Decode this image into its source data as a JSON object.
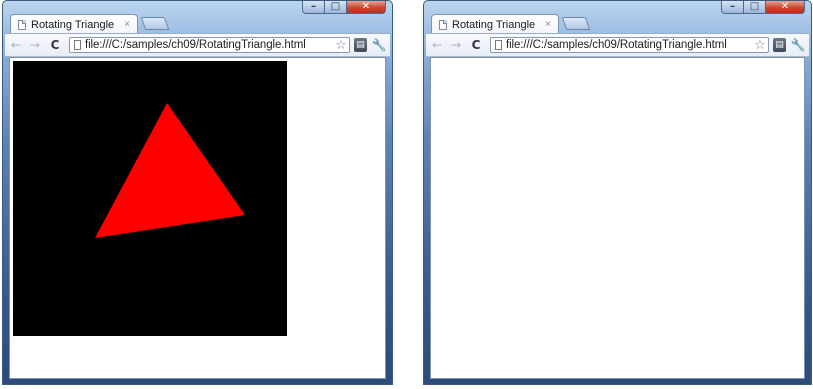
{
  "windows": [
    {
      "tab": {
        "title": "Rotating Triangle",
        "close": "×"
      },
      "url": "file:///C:/samples/ch09/RotatingTriangle.html",
      "canvas_visible": true
    },
    {
      "tab": {
        "title": "Rotating Triangle",
        "close": "×"
      },
      "url": "file:///C:/samples/ch09/RotatingTriangle.html",
      "canvas_visible": false
    }
  ],
  "icons": {
    "back": "back-arrow-icon",
    "forward": "forward-arrow-icon",
    "reload": "reload-icon",
    "star": "star-icon",
    "page_menu": "page-menu-icon",
    "wrench": "wrench-icon",
    "minimize": "minimize-icon",
    "maximize": "maximize-icon",
    "close": "close-icon"
  },
  "colors": {
    "triangle": "#ff0000",
    "canvas_background": "#000000"
  }
}
